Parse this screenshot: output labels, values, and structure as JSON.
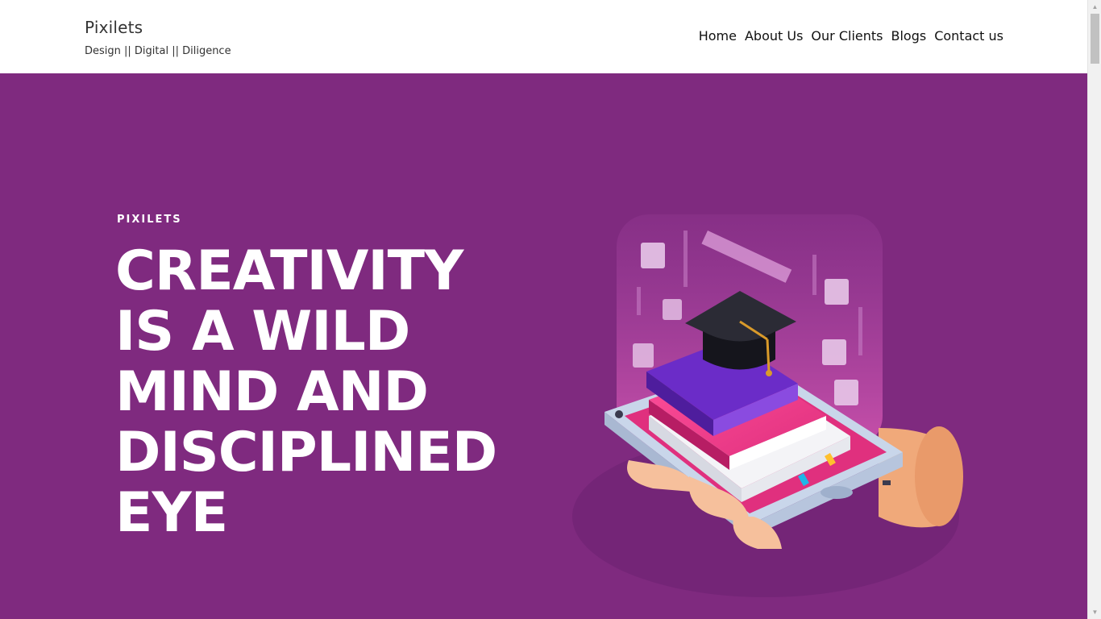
{
  "brand": {
    "title": "Pixilets",
    "tagline": "Design || Digital || Diligence"
  },
  "nav": {
    "items": [
      "Home",
      "About Us",
      "Our Clients",
      "Blogs",
      "Contact us"
    ]
  },
  "hero": {
    "eyebrow": "PIXILETS",
    "headline_lines": [
      "CREATIVITY",
      "IS A WILD",
      "MIND AND",
      "DISCIPLINED",
      "EYE"
    ],
    "background_color": "#7f2a7f",
    "illustration_icon": "graduation-cap-books-on-phone-illustration"
  },
  "scrollbar": {
    "up_icon": "triangle-up-icon",
    "down_icon": "triangle-down-icon"
  }
}
